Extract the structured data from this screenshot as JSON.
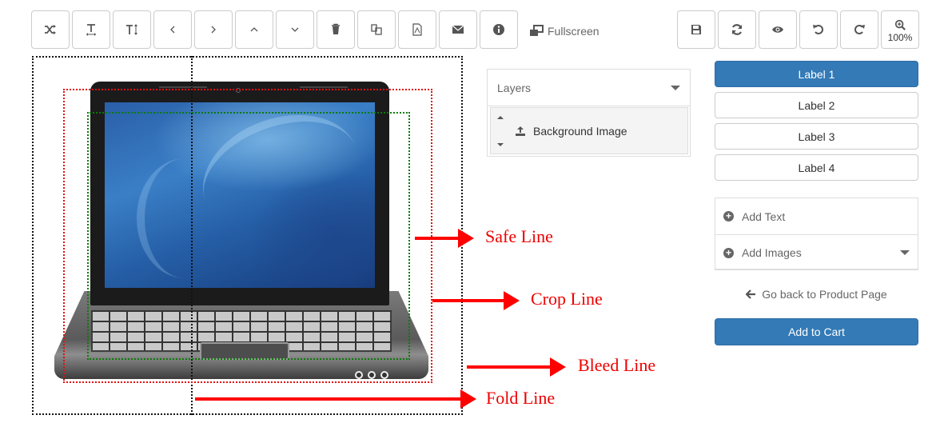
{
  "toolbar": {
    "left_buttons": [
      {
        "icon": "shuffle-icon",
        "tooltip": ""
      },
      {
        "icon": "text-width-icon"
      },
      {
        "icon": "text-height-icon"
      },
      {
        "icon": "chevron-left-icon"
      },
      {
        "icon": "chevron-right-icon"
      },
      {
        "icon": "chevron-up-icon"
      },
      {
        "icon": "chevron-down-icon"
      },
      {
        "icon": "trash-icon"
      },
      {
        "icon": "copy-icon"
      },
      {
        "icon": "pdf-file-icon"
      },
      {
        "icon": "envelope-icon"
      },
      {
        "icon": "info-icon"
      }
    ],
    "fullscreen_label": "Fullscreen",
    "right_buttons": [
      {
        "icon": "save-icon"
      },
      {
        "icon": "refresh-icon"
      },
      {
        "icon": "eye-icon"
      },
      {
        "icon": "undo-icon"
      },
      {
        "icon": "redo-icon"
      }
    ],
    "zoom_level": "100%"
  },
  "canvas": {
    "annotations": {
      "safe": "Safe Line",
      "crop": "Crop Line",
      "bleed": "Bleed Line",
      "fold": "Fold Line"
    },
    "colors": {
      "bleed_line": "#111111",
      "crop_line": "#e01010",
      "safe_line": "#0a7a0a",
      "annotation": "#ee0000"
    }
  },
  "layers": {
    "title": "Layers",
    "items": [
      {
        "label": "Background Image",
        "icon": "upload-icon"
      }
    ]
  },
  "sidebar": {
    "labels": [
      {
        "label": "Label 1",
        "active": true
      },
      {
        "label": "Label 2",
        "active": false
      },
      {
        "label": "Label 3",
        "active": false
      },
      {
        "label": "Label 4",
        "active": false
      }
    ],
    "add_text": "Add Text",
    "add_images": "Add Images",
    "back_link": "Go back to Product Page",
    "add_to_cart": "Add to Cart",
    "accent_color": "#337ab7"
  }
}
